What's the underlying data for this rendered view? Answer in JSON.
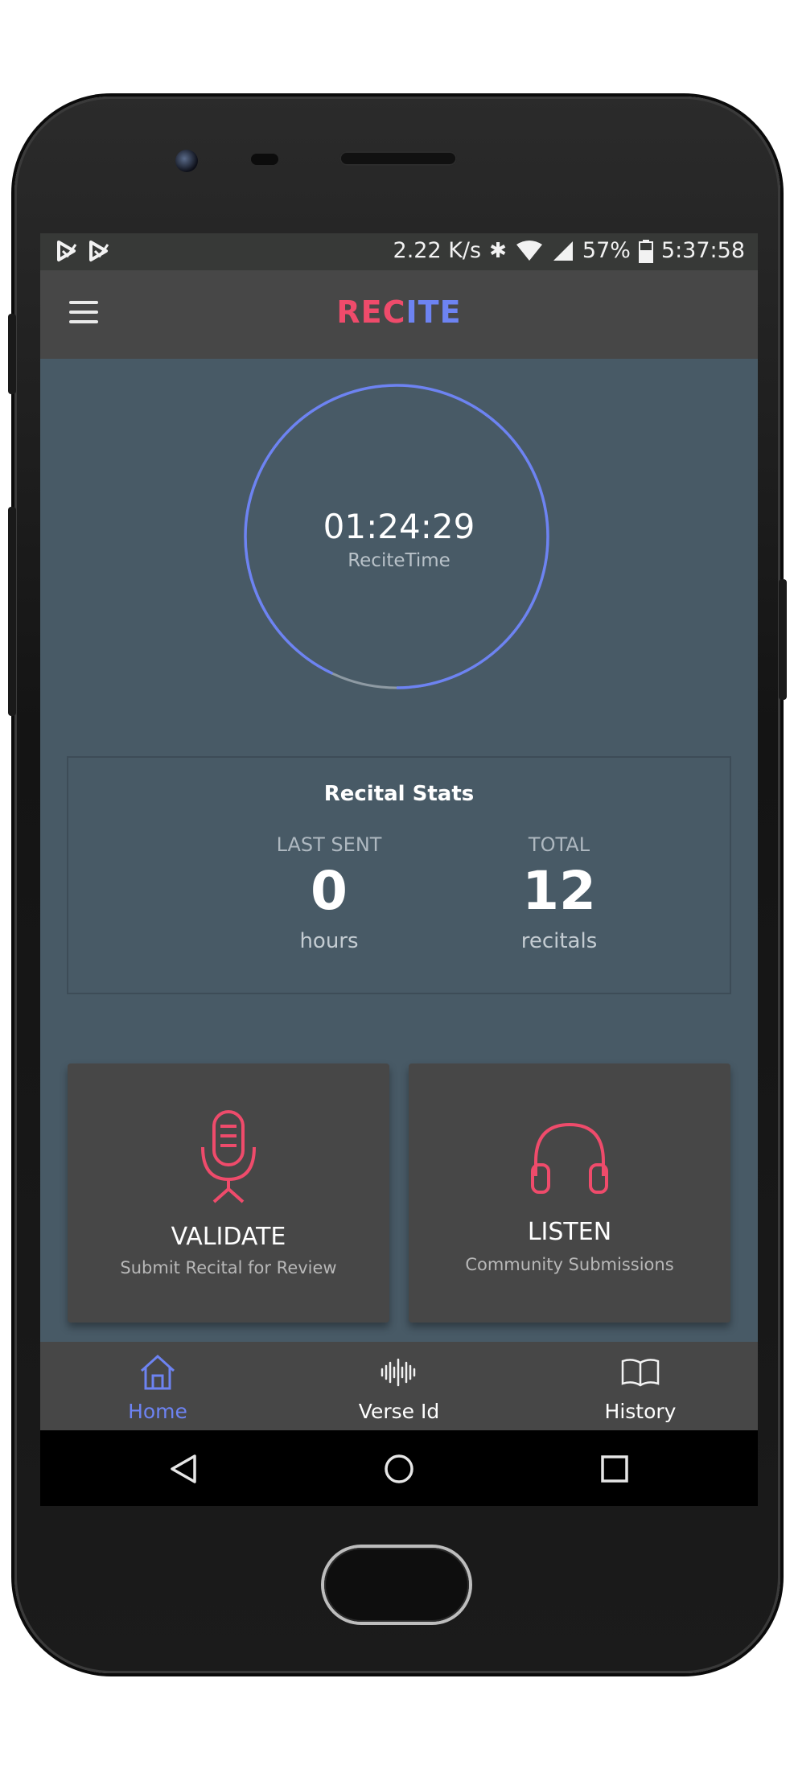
{
  "status_bar": {
    "notif_icons": [
      "play-store-icon",
      "play-store-icon"
    ],
    "net_speed": "2.22 K/s",
    "battery": "57%",
    "time": "5:37:58"
  },
  "app_bar": {
    "title_part1": "REC",
    "title_part2": "ITE",
    "title_colors": {
      "red": "#ef4b6b",
      "blue": "#6d83f2"
    }
  },
  "timer": {
    "value": "01:24:29",
    "label": "ReciteTime",
    "ring_color": "#6d83f2",
    "progress_fraction": 0.93
  },
  "stats": {
    "title": "Recital Stats",
    "last_sent": {
      "label": "LAST SENT",
      "value": "0",
      "unit": "hours"
    },
    "total": {
      "label": "TOTAL",
      "value": "12",
      "unit": "recitals"
    }
  },
  "actions": {
    "validate": {
      "title": "VALIDATE",
      "subtitle": "Submit Recital for Review",
      "icon": "microphone-icon"
    },
    "listen": {
      "title": "LISTEN",
      "subtitle": "Community Submissions",
      "icon": "headphones-icon"
    }
  },
  "bottom_nav": {
    "items": [
      {
        "label": "Home",
        "icon": "home-icon",
        "active": true
      },
      {
        "label": "Verse Id",
        "icon": "waveform-icon",
        "active": false
      },
      {
        "label": "History",
        "icon": "book-icon",
        "active": false
      }
    ],
    "active_color": "#6d83f2"
  },
  "colors": {
    "content_bg": "#485a66",
    "bar_bg": "#474747",
    "accent_red": "#ef4b6b"
  }
}
